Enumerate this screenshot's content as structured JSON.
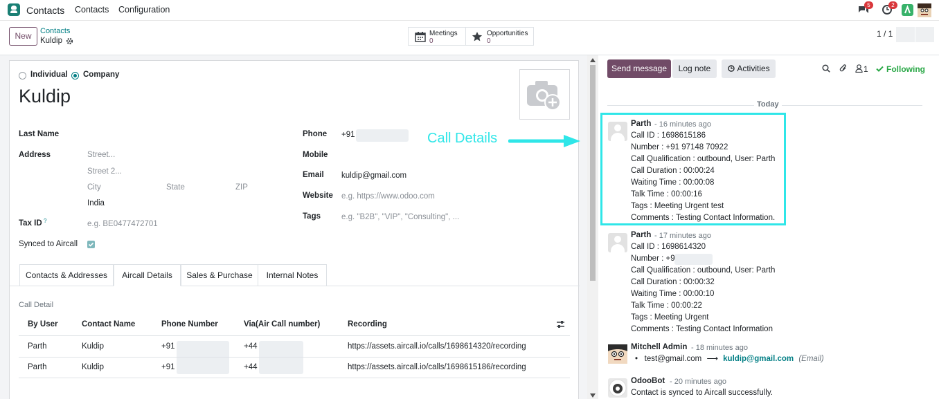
{
  "navbar": {
    "app_title": "Contacts",
    "menu": [
      "Contacts",
      "Configuration"
    ],
    "chat_badge": "5",
    "activity_badge": "2"
  },
  "control": {
    "new_label": "New",
    "breadcrumb_parent": "Contacts",
    "breadcrumb_current": "Kuldip",
    "smart_buttons": [
      {
        "label": "Meetings",
        "value": "0"
      },
      {
        "label": "Opportunities",
        "value": "0"
      }
    ],
    "pager": "1 / 1"
  },
  "form": {
    "type_individual": "Individual",
    "type_company": "Company",
    "name": "Kuldip",
    "last_name_label": "Last Name",
    "address_label": "Address",
    "street_ph": "Street...",
    "street2_ph": "Street 2...",
    "city_ph": "City",
    "state_ph": "State",
    "zip_ph": "ZIP",
    "country": "India",
    "tax_label": "Tax ID",
    "tax_help": "?",
    "tax_ph": "e.g. BE0477472701",
    "synced_label": "Synced to Aircall",
    "phone_label": "Phone",
    "phone_prefix": "+91",
    "mobile_label": "Mobile",
    "email_label": "Email",
    "email": "kuldip@gmail.com",
    "website_label": "Website",
    "website_ph": "e.g. https://www.odoo.com",
    "tags_label": "Tags",
    "tags_ph": "e.g. \"B2B\", \"VIP\", \"Consulting\", ..."
  },
  "tabs": [
    "Contacts & Addresses",
    "Aircall Details",
    "Sales & Purchase",
    "Internal Notes"
  ],
  "call_detail": {
    "title": "Call Detail",
    "columns": [
      "By User",
      "Contact Name",
      "Phone Number",
      "Via(Air Call number)",
      "Recording"
    ],
    "rows": [
      {
        "user": "Parth",
        "contact": "Kuldip",
        "phone": "+91",
        "via": "+44",
        "recording": "https://assets.aircall.io/calls/1698614320/recording"
      },
      {
        "user": "Parth",
        "contact": "Kuldip",
        "phone": "+91",
        "via": "+44",
        "recording": "https://assets.aircall.io/calls/1698615186/recording"
      }
    ]
  },
  "chatter": {
    "send_message": "Send message",
    "log_note": "Log note",
    "activities": "Activities",
    "followers_count": "1",
    "following": "Following",
    "today": "Today",
    "messages": [
      {
        "author": "Parth",
        "ago": "- 16 minutes ago",
        "lines": [
          "Call ID : 1698615186",
          "Number : +91 97148 70922",
          "Call Qualification : outbound, User: Parth",
          "Call Duration : 00:00:24",
          "Waiting Time : 00:00:08",
          "Talk Time : 00:00:16",
          "Tags : Meeting Urgent test",
          "Comments : Testing Contact Information."
        ]
      },
      {
        "author": "Parth",
        "ago": "- 17 minutes ago",
        "lines": [
          "Call ID : 1698614320",
          "Number : +91",
          "Call Qualification : outbound, User: Parth",
          "Call Duration : 00:00:32",
          "Waiting Time : 00:00:10",
          "Talk Time : 00:00:22",
          "Tags : Meeting Urgent",
          "Comments : Testing Contact Information"
        ]
      },
      {
        "author": "Mitchell Admin",
        "ago": "- 18 minutes ago",
        "old_email": "test@gmail.com",
        "arrow": "⟶",
        "new_email": "kuldip@gmail.com",
        "field": "(Email)"
      },
      {
        "author": "OdooBot",
        "ago": "- 20 minutes ago",
        "lines": [
          "Contact is synced to Aircall successfully."
        ]
      }
    ]
  },
  "annotation": {
    "text": "Call Details",
    "color": "#2fe6e8"
  },
  "colors": {
    "primary": "#714b67",
    "link": "#017e84"
  }
}
